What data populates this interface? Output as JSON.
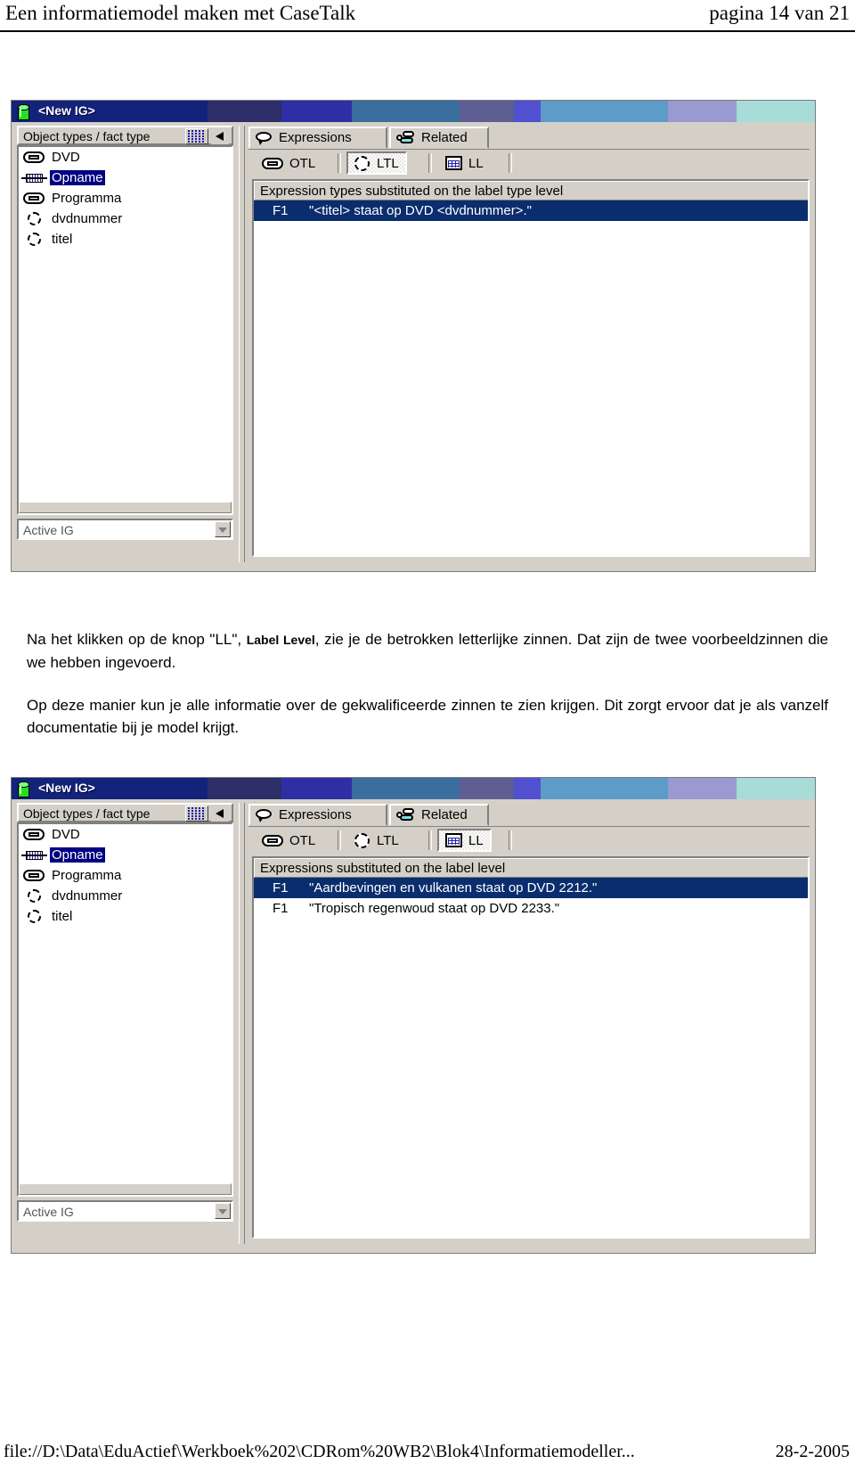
{
  "page": {
    "header_title": "Een informatiemodel maken met CaseTalk",
    "header_page": "pagina 14 van 21",
    "footer_path": "file://D:\\Data\\EduActief\\Werkboek%202\\CDRom%20WB2\\Blok4\\Informatiemodeller...",
    "footer_date": "28-2-2005"
  },
  "colors": {
    "titlebar_start": "#13227a",
    "titlebar_accent": "#3a6e9e",
    "selection_blue": "#0a2d6e",
    "tree_selection": "#000080",
    "window_face": "#d4d0c8",
    "icon_green": "#20e020"
  },
  "screenshot_one": {
    "window_title": "<New IG>",
    "left_panel": {
      "header_label": "Object types / fact type",
      "grid_button_name": "grid-view",
      "arrow_button_name": "collapse-arrow",
      "items": [
        {
          "label": "DVD",
          "icon": "object-type-icon",
          "selected": false
        },
        {
          "label": "Opname",
          "icon": "fact-type-icon",
          "selected": true
        },
        {
          "label": "Programma",
          "icon": "object-type-icon",
          "selected": false
        },
        {
          "label": "dvdnummer",
          "icon": "label-type-icon",
          "selected": false
        },
        {
          "label": "titel",
          "icon": "label-type-icon",
          "selected": false
        }
      ],
      "combo_value": "Active IG"
    },
    "tabs": [
      {
        "label": "Expressions",
        "accel": "x",
        "icon": "speech-bubble-icon",
        "active": true
      },
      {
        "label": "Related",
        "accel": "R",
        "icon": "related-nodes-icon",
        "active": false
      }
    ],
    "level_buttons": [
      {
        "label": "OTL",
        "accel": "O",
        "icon": "object-type-icon",
        "pressed": false
      },
      {
        "label": "LTL",
        "accel": "T",
        "icon": "label-type-icon",
        "pressed": true
      },
      {
        "label": "LL",
        "accel": "L",
        "icon": "table-grid-icon",
        "pressed": false
      }
    ],
    "expression_list": {
      "header": "Expression types substituted on the label type level",
      "rows": [
        {
          "code": "F1",
          "text": "\"<titel> staat op DVD <dvdnummer>.\"",
          "selected": true
        }
      ]
    }
  },
  "screenshot_two": {
    "window_title": "<New IG>",
    "left_panel": {
      "header_label": "Object types / fact type",
      "grid_button_name": "grid-view",
      "arrow_button_name": "collapse-arrow",
      "items": [
        {
          "label": "DVD",
          "icon": "object-type-icon",
          "selected": false
        },
        {
          "label": "Opname",
          "icon": "fact-type-icon",
          "selected": true
        },
        {
          "label": "Programma",
          "icon": "object-type-icon",
          "selected": false
        },
        {
          "label": "dvdnummer",
          "icon": "label-type-icon",
          "selected": false
        },
        {
          "label": "titel",
          "icon": "label-type-icon",
          "selected": false
        }
      ],
      "combo_value": "Active IG"
    },
    "tabs": [
      {
        "label": "Expressions",
        "accel": "x",
        "icon": "speech-bubble-icon",
        "active": true
      },
      {
        "label": "Related",
        "accel": "R",
        "icon": "related-nodes-icon",
        "active": false
      }
    ],
    "level_buttons": [
      {
        "label": "OTL",
        "accel": "O",
        "icon": "object-type-icon",
        "pressed": false
      },
      {
        "label": "LTL",
        "accel": "T",
        "icon": "label-type-icon",
        "pressed": false
      },
      {
        "label": "LL",
        "accel": "L",
        "icon": "table-grid-icon",
        "pressed": true
      }
    ],
    "expression_list": {
      "header": "Expressions substituted on the label level",
      "rows": [
        {
          "code": "F1",
          "text": "\"Aardbevingen en vulkanen staat op DVD 2212.\"",
          "selected": true
        },
        {
          "code": "F1",
          "text": "\"Tropisch regenwoud staat op DVD 2233.\"",
          "selected": false
        }
      ]
    }
  },
  "body_text": {
    "paragraph_1_part_1": "Na het klikken op de knop \"LL\", ",
    "paragraph_1_bold": "Label Level",
    "paragraph_1_part_2": ", zie je de betrokken letterlijke zinnen. Dat zijn de twee voorbeeldzinnen die we hebben ingevoerd.",
    "paragraph_2": "Op deze manier kun je alle informatie over de gekwalificeerde zinnen te zien krijgen. Dit zorgt ervoor dat je als vanzelf documentatie bij je model krijgt."
  }
}
